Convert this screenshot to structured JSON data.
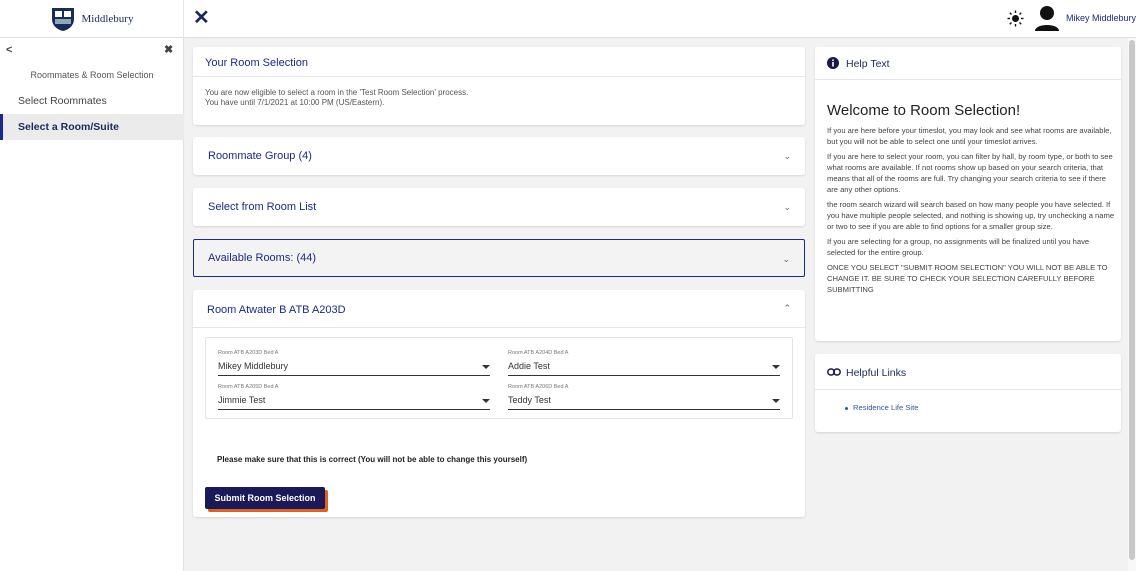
{
  "header": {
    "logo_text": "Middlebury",
    "user_name": "Mikey Middlebury"
  },
  "sidebar": {
    "title": "Roommates & Room Selection",
    "items": [
      {
        "label": "Select Roommates"
      },
      {
        "label": "Select a Room/Suite"
      }
    ]
  },
  "selection": {
    "title": "Your Room Selection",
    "line1": "You are now eligible to select a room in the 'Test Room Selection' process.",
    "line2": "You have until 7/1/2021 at 10:00 PM (US/Eastern)."
  },
  "panels": {
    "roommate_group": "Roommate Group (4)",
    "room_list": "Select from Room List",
    "available": "Available Rooms: (44)"
  },
  "room": {
    "title": "Room Atwater B ATB A203D",
    "beds": [
      {
        "label": "Room ATB A203D Bed A",
        "value": "Mikey Middlebury"
      },
      {
        "label": "Room ATB A204D Bed A",
        "value": "Addie Test"
      },
      {
        "label": "Room ATB A205D Bed A",
        "value": "Jimmie Test"
      },
      {
        "label": "Room ATB A206D Bed A",
        "value": "Teddy Test"
      }
    ],
    "confirm": "Please make sure that this is correct (You will not be able to change this yourself)",
    "submit": "Submit Room Selection"
  },
  "help": {
    "title": "Help Text",
    "welcome": "Welcome to Room Selection!",
    "paragraphs": [
      "If you are here before your timeslot, you may look and see what rooms are available, but you will not be able to select one until your timeslot arrives.",
      "If you are here to select your room, you can filter by hall, by room type, or both to see what rooms are available. If not rooms show up based on your search criteria, that means that all of the rooms are full. Try changing your search criteria to see if there are any other options.",
      "the room search wizard will search based on how many people you have selected. If you have multiple people selected, and nothing is showing up, try unchecking a name or two to see if you are able to find options for a smaller group size.",
      "If you are selecting for a group, no assignments will be finalized until you have selected for the entire group.",
      "ONCE YOU SELECT \"SUBMIT ROOM SELECTION\" YOU WILL NOT BE ABLE TO CHANGE IT. BE SURE TO CHECK YOUR SELECTION CAREFULLY BEFORE SUBMITTING"
    ]
  },
  "links": {
    "title": "Helpful Links",
    "items": [
      {
        "label": "Residence Life Site"
      }
    ]
  },
  "icons": {
    "close": "close-icon",
    "theme": "sun-icon",
    "user": "user-avatar-icon",
    "info": "info-icon",
    "link": "link-icon",
    "accent": "#1a2a8a",
    "button_shadow": "#e06020"
  }
}
